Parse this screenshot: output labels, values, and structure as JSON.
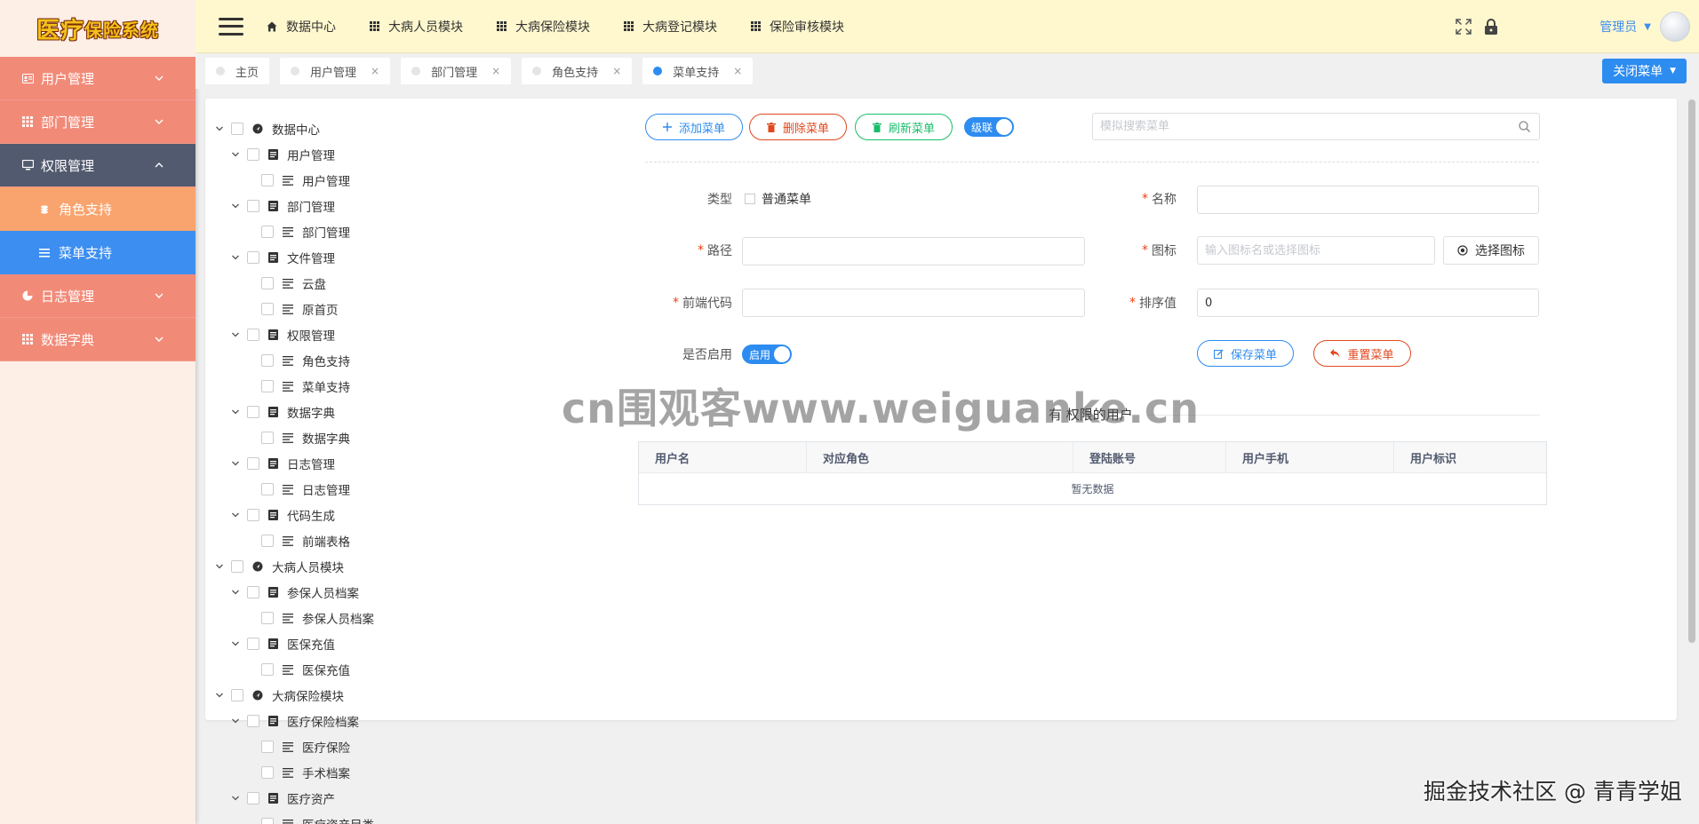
{
  "app": {
    "logo_main": "医疗",
    "logo_small": "保险系统"
  },
  "sidebar": {
    "items": [
      {
        "label": "用户管理",
        "icon": "user-card-icon"
      },
      {
        "label": "部门管理",
        "icon": "grid-icon"
      },
      {
        "label": "权限管理",
        "icon": "monitor-icon",
        "active": true
      },
      {
        "label": "角色支持",
        "icon": "coins-icon",
        "sub": true
      },
      {
        "label": "菜单支持",
        "icon": "list-icon",
        "sub": true,
        "selected": true
      },
      {
        "label": "日志管理",
        "icon": "pie-icon"
      },
      {
        "label": "数据字典",
        "icon": "grid-icon"
      }
    ]
  },
  "topnav": {
    "items": [
      "数据中心",
      "大病人员模块",
      "大病保险模块",
      "大病登记模块",
      "保险审核模块"
    ],
    "user": "管理员"
  },
  "tabs": {
    "items": [
      {
        "label": "主页",
        "closable": false
      },
      {
        "label": "用户管理",
        "closable": true
      },
      {
        "label": "部门管理",
        "closable": true
      },
      {
        "label": "角色支持",
        "closable": true
      },
      {
        "label": "菜单支持",
        "closable": true,
        "active": true
      }
    ],
    "close_button": "关闭菜单",
    "close_glyph": "×"
  },
  "tree": {
    "nodes": [
      {
        "label": "数据中心",
        "level": 0,
        "kind": "root"
      },
      {
        "label": "用户管理",
        "level": 1,
        "kind": "folder"
      },
      {
        "label": "用户管理",
        "level": 2,
        "kind": "leaf"
      },
      {
        "label": "部门管理",
        "level": 1,
        "kind": "folder"
      },
      {
        "label": "部门管理",
        "level": 2,
        "kind": "leaf"
      },
      {
        "label": "文件管理",
        "level": 1,
        "kind": "folder"
      },
      {
        "label": "云盘",
        "level": 2,
        "kind": "leaf"
      },
      {
        "label": "原首页",
        "level": 2,
        "kind": "leaf"
      },
      {
        "label": "权限管理",
        "level": 1,
        "kind": "folder"
      },
      {
        "label": "角色支持",
        "level": 2,
        "kind": "leaf"
      },
      {
        "label": "菜单支持",
        "level": 2,
        "kind": "leaf"
      },
      {
        "label": "数据字典",
        "level": 1,
        "kind": "folder"
      },
      {
        "label": "数据字典",
        "level": 2,
        "kind": "leaf"
      },
      {
        "label": "日志管理",
        "level": 1,
        "kind": "folder"
      },
      {
        "label": "日志管理",
        "level": 2,
        "kind": "leaf"
      },
      {
        "label": "代码生成",
        "level": 1,
        "kind": "folder"
      },
      {
        "label": "前端表格",
        "level": 2,
        "kind": "leaf"
      },
      {
        "label": "大病人员模块",
        "level": 0,
        "kind": "root"
      },
      {
        "label": "参保人员档案",
        "level": 1,
        "kind": "folder"
      },
      {
        "label": "参保人员档案",
        "level": 2,
        "kind": "leaf"
      },
      {
        "label": "医保充值",
        "level": 1,
        "kind": "folder"
      },
      {
        "label": "医保充值",
        "level": 2,
        "kind": "leaf"
      },
      {
        "label": "大病保险模块",
        "level": 0,
        "kind": "root"
      },
      {
        "label": "医疗保险档案",
        "level": 1,
        "kind": "folder"
      },
      {
        "label": "医疗保险",
        "level": 2,
        "kind": "leaf"
      },
      {
        "label": "手术档案",
        "level": 2,
        "kind": "leaf"
      },
      {
        "label": "医疗资产",
        "level": 1,
        "kind": "folder"
      },
      {
        "label": "医疗资产目类",
        "level": 2,
        "kind": "leaf"
      }
    ]
  },
  "toolbar": {
    "add": "添加菜单",
    "delete": "删除菜单",
    "refresh": "刷新菜单",
    "cascade": "级联",
    "search_placeholder": "模拟搜索菜单"
  },
  "form": {
    "type_label": "类型",
    "type_option": "普通菜单",
    "name_label": "名称",
    "name_value": "",
    "path_label": "路径",
    "path_value": "",
    "icon_label": "图标",
    "icon_placeholder": "输入图标名或选择图标",
    "pick_icon": "选择图标",
    "code_label": "前端代码",
    "code_value": "",
    "sort_label": "排序值",
    "sort_value": "0",
    "enable_label": "是否启用",
    "enable_switch": "启用",
    "save": "保存菜单",
    "reset": "重置菜单",
    "required_mark": "*"
  },
  "users_section": {
    "title": "有 权限的用户",
    "columns": [
      "用户名",
      "对应角色",
      "登陆账号",
      "用户手机",
      "用户标识"
    ],
    "empty": "暂无数据"
  },
  "watermarks": {
    "center": "cn围观客www.weiguanke.cn",
    "bottom": "掘金技术社区 @ 青青学姐"
  },
  "colors": {
    "sidebar_item": "#f28a78",
    "sidebar_active": "#515a6e",
    "sidebar_sub": "#f9a36e",
    "sidebar_selected": "#3c8ef0",
    "topbar": "#fff8cf",
    "primary": "#2d8cf0",
    "danger": "#e1471f",
    "success": "#19be6b"
  }
}
